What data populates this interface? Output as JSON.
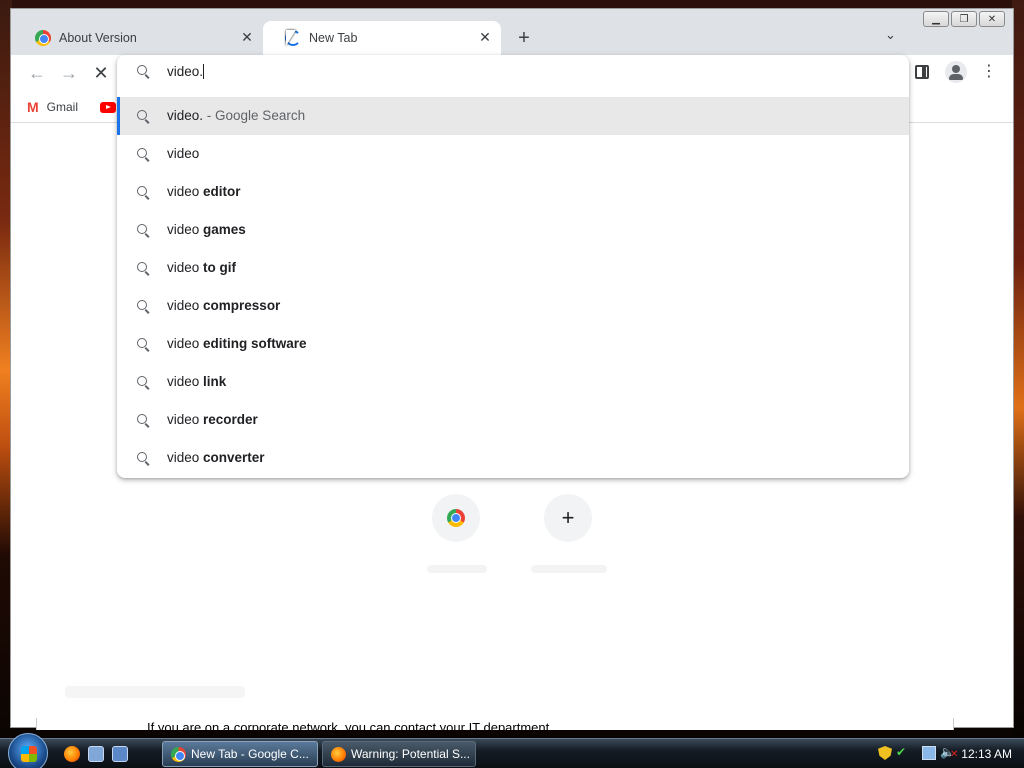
{
  "tabs": [
    {
      "title": "About Version",
      "active": false
    },
    {
      "title": "New Tab",
      "active": true
    }
  ],
  "omnibox": {
    "value": "video.",
    "suggestions": [
      {
        "text": "video.",
        "bold": "",
        "desc": " - Google Search",
        "selected": true
      },
      {
        "text": "video",
        "bold": "",
        "desc": ""
      },
      {
        "text": "video ",
        "bold": "editor",
        "desc": ""
      },
      {
        "text": "video ",
        "bold": "games",
        "desc": ""
      },
      {
        "text": "video ",
        "bold": "to gif",
        "desc": ""
      },
      {
        "text": "video ",
        "bold": "compressor",
        "desc": ""
      },
      {
        "text": "video ",
        "bold": "editing software",
        "desc": ""
      },
      {
        "text": "video ",
        "bold": "link",
        "desc": ""
      },
      {
        "text": "video ",
        "bold": "recorder",
        "desc": ""
      },
      {
        "text": "video ",
        "bold": "converter",
        "desc": ""
      }
    ]
  },
  "bookmarks": {
    "gmail_label": "Gmail"
  },
  "page": {
    "strip_text": "If you are on a corporate network, you can contact your IT department"
  },
  "taskbar": {
    "items": [
      {
        "label": "New Tab - Google C..."
      },
      {
        "label": "Warning: Potential S..."
      }
    ],
    "clock": "12:13 AM"
  },
  "colors": {
    "accent": "#1a73e8",
    "selected_bg": "#e8e8e8"
  }
}
